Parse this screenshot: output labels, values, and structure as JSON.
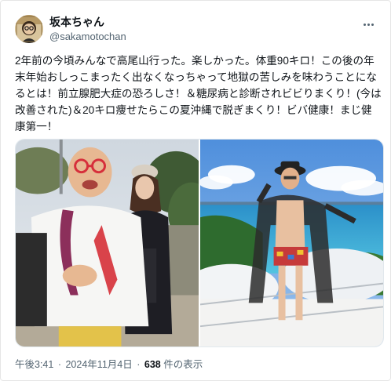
{
  "author": {
    "display_name": "坂本ちゃん",
    "handle": "@sakamotochan"
  },
  "tweet": {
    "text": "2年前の今頃みんなで高尾山行った。楽しかった。体重90キロ！この後の年末年始おしっこまったく出なくなっちゃって地獄の苦しみを味わうことになるとは！前立腺肥大症の恐ろしさ！＆糖尿病と診断されビビりまくり！(今は改善された)＆20キロ痩せたらこの夏沖縄で脱ぎまくり！ビバ健康！まじ健康第一！"
  },
  "meta": {
    "time": "午後3:41",
    "separator": "·",
    "date": "2024年11月4日",
    "views_count": "638",
    "views_label": "件の表示"
  },
  "colors": {
    "text_primary": "#0f1419",
    "text_secondary": "#536471",
    "border": "#e6e6e6"
  },
  "icons": {
    "more": "more-horizontal-icon"
  }
}
